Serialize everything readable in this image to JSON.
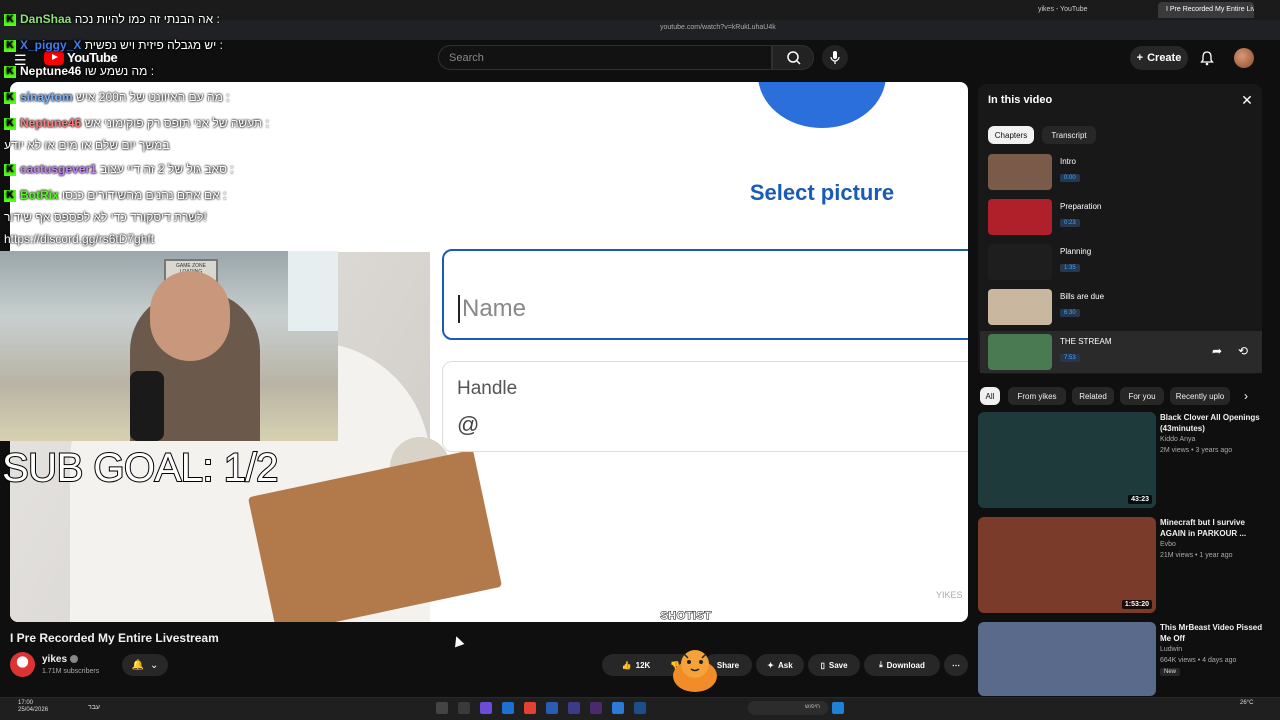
{
  "browser": {
    "tabs": [
      {
        "label": "yikes - YouTube"
      },
      {
        "label": "I Pre Recorded My Entire Livestream"
      }
    ],
    "url": "youtube.com/watch?v=kRukLuhaU4k"
  },
  "header": {
    "logo_text": "YouTube",
    "search_placeholder": "Search",
    "create_label": "Create"
  },
  "stream_overlay": {
    "chat": [
      {
        "name": "DanShaa",
        "message": "אה הבנתי זה כמו להיות נכה :"
      },
      {
        "name": "X_piggy_X",
        "message": "יש מגבלה פיזית ויש נפשית :"
      },
      {
        "name": "Neptune46",
        "message": "מה נשמע שו :"
      },
      {
        "name": "sinaytom",
        "message": "מה עם האיוונט של ה200 איש :"
      },
      {
        "name": "Neptune46",
        "message": "תעשה של אני תופס רק פוקימוני אש :"
      },
      {
        "name": "",
        "message": "במשך יום שלם או מים או לא יודע"
      },
      {
        "name": "cactusgever1",
        "message": "סאב גול של 2 זה דיי עצוב :"
      },
      {
        "name": "BotRix",
        "message": "אם אתם נהנים מהשידורים כנסו :"
      },
      {
        "name": "",
        "message": "לשרת דיסקורד כדי לא לפספס אף שידור!"
      },
      {
        "name": "",
        "message": "https://discord.gg/rs6tD7ghft"
      }
    ],
    "sub_goal": "SUB GOAL: 1/2",
    "shotist": "SHOTIST",
    "webcam_sign": "GAME ZONE LOADING"
  },
  "video": {
    "select_picture": "Select picture",
    "name_placeholder": "Name",
    "handle_label": "Handle",
    "handle_prefix": "@",
    "watermark": "YIKES",
    "title": "I Pre Recorded My Entire Livestream"
  },
  "channel": {
    "name": "yikes",
    "subscribers": "1.71M subscribers"
  },
  "actions": {
    "likes": "12K",
    "share": "Share",
    "ask": "Ask",
    "save": "Save",
    "download": "Download"
  },
  "panel": {
    "title": "In this video",
    "tabs": [
      "Chapters",
      "Transcript"
    ],
    "chapters": [
      {
        "title": "Intro",
        "time": "0:00",
        "thumb_color": "#7a5a48"
      },
      {
        "title": "Preparation",
        "time": "0:23",
        "thumb_color": "#b0202a"
      },
      {
        "title": "Planning",
        "time": "1:35",
        "thumb_color": "#1e1e1e"
      },
      {
        "title": "Bills are due",
        "time": "6:30",
        "thumb_color": "#c9b7a0"
      },
      {
        "title": "THE STREAM",
        "time": "7:53",
        "thumb_color": "#4a7a52"
      }
    ]
  },
  "chips": [
    "All",
    "From yikes",
    "Related",
    "For you",
    "Recently uplo"
  ],
  "recommendations": [
    {
      "title": "Black Clover All Openings (43minutes)",
      "channel": "Kiddo Anya",
      "meta": "2M views • 3 years ago",
      "duration": "43:23",
      "badge": "",
      "thumb_color": "#1e3a3a"
    },
    {
      "title": "Minecraft but I survive AGAIN in PARKOUR ...",
      "channel": "Evbo",
      "meta": "21M views • 1 year ago",
      "duration": "1:53:20",
      "badge": "",
      "thumb_color": "#7a3b2a"
    },
    {
      "title": "This MrBeast Video Pissed Me Off",
      "channel": "Ludwin",
      "meta": "664K views • 4 days ago",
      "duration": "",
      "badge": "New",
      "thumb_color": "#5a6a8a"
    }
  ],
  "taskbar": {
    "time": "17:00",
    "date": "25/04/2026",
    "lang": "עבר",
    "search": "חיפוש",
    "weather": "26°C"
  },
  "colors": {
    "accent": "#3ea6ff",
    "kick_green": "#53fc18",
    "yt_red": "#ff0000",
    "select_blue": "#1a5bb7"
  }
}
